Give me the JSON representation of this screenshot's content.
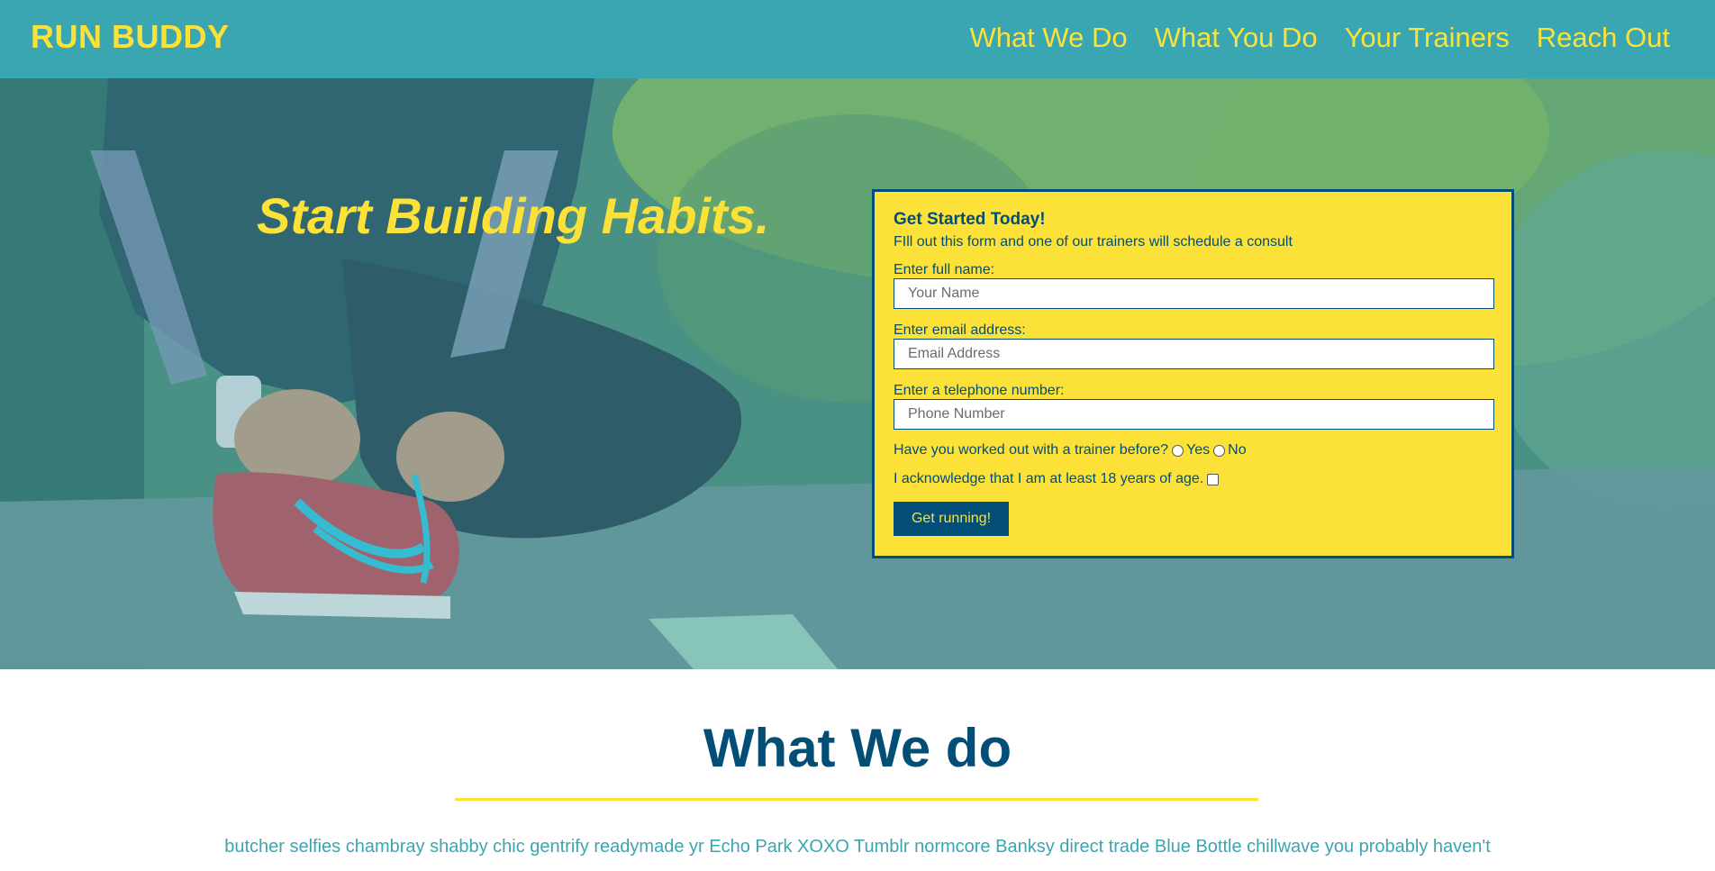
{
  "header": {
    "logo": "RUN BUDDY",
    "nav": [
      {
        "label": "What We Do"
      },
      {
        "label": "What You Do"
      },
      {
        "label": "Your Trainers"
      },
      {
        "label": "Reach Out"
      }
    ]
  },
  "hero": {
    "cta": "Start Building Habits."
  },
  "form": {
    "title": "Get Started Today!",
    "description": "FIll out this form and one of our trainers will schedule a consult",
    "name_label": "Enter full name:",
    "name_placeholder": "Your Name",
    "email_label": "Enter email address:",
    "email_placeholder": "Email Address",
    "phone_label": "Enter a telephone number:",
    "phone_placeholder": "Phone Number",
    "trainer_question": "Have you worked out with a trainer before?",
    "yes_label": "Yes",
    "no_label": "No",
    "age_ack": "I acknowledge that I am at least 18 years of age.",
    "submit_label": "Get running!"
  },
  "what_we_do": {
    "title": "What We do",
    "text": "butcher selfies chambray shabby chic gentrify readymade yr Echo Park XOXO Tumblr normcore Banksy direct trade Blue Bottle chillwave you probably haven't"
  },
  "colors": {
    "header_bg": "#39a6b2",
    "accent_yellow": "#fce138",
    "dark_blue": "#024e76"
  }
}
